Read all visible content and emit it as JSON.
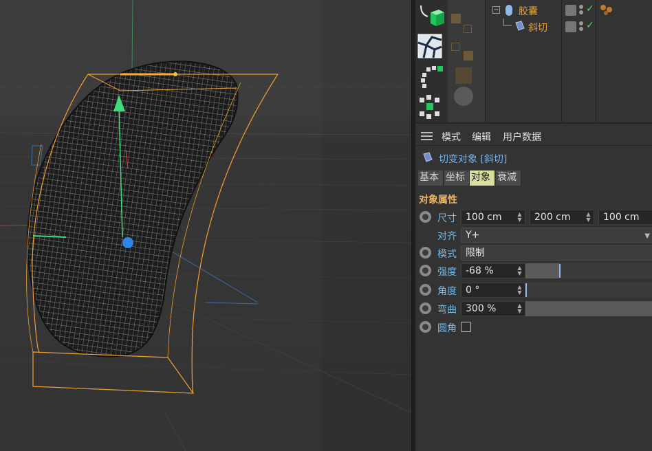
{
  "object_manager": {
    "items": [
      {
        "name": "胶囊",
        "icon": "capsule-icon"
      },
      {
        "name": "斜切",
        "icon": "shear-deformer-icon"
      }
    ]
  },
  "attribute_manager": {
    "menu": [
      "模式",
      "编辑",
      "用户数据"
    ],
    "object_title": "切变对象 [斜切]",
    "tabs": [
      {
        "label": "基本",
        "active": false
      },
      {
        "label": "坐标",
        "active": false
      },
      {
        "label": "对象",
        "active": true
      },
      {
        "label": "衰减",
        "active": false
      }
    ],
    "section_title": "对象属性",
    "properties": {
      "size": {
        "label": "尺寸",
        "x": "100 cm",
        "y": "200 cm",
        "z": "100 cm"
      },
      "align": {
        "label": "对齐",
        "value": "Y+"
      },
      "mode": {
        "label": "模式",
        "value": "限制"
      },
      "strength": {
        "label": "强度",
        "value": "-68 %",
        "slider_fraction": 0.1
      },
      "angle": {
        "label": "角度",
        "value": "0 °",
        "slider_fraction": 0.0
      },
      "curvature": {
        "label": "弯曲",
        "value": "300 %",
        "slider_fraction": 1.0
      },
      "fillet": {
        "label": "圆角",
        "checked": false
      }
    }
  },
  "colors": {
    "accent_orange": "#e8a33a",
    "label_blue": "#74b7e3",
    "active_tab": "#d7dea0",
    "check_green": "#5fd16b",
    "cage_orange": "#f0a030",
    "y_axis_green": "#3cdc7a",
    "gizmo_blue": "#2f86e8"
  }
}
